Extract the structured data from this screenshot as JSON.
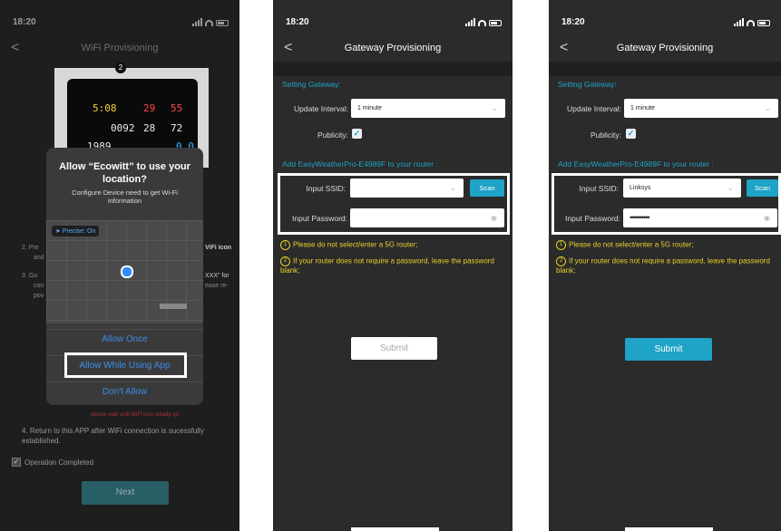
{
  "screen1": {
    "status_time": "18:20",
    "back_glyph": "<",
    "nav_title": "WiFi Provisioning",
    "device_marker": "2",
    "lcd_values": [
      "5:08",
      "29",
      "55",
      "0092",
      "28",
      "72",
      "1989",
      "0.0"
    ],
    "dialog": {
      "title": "Allow “Ecowitt” to use your location?",
      "subtitle": "Configure Device need to get Wi-Fi information",
      "precise_label": "Precise: On",
      "allow_once": "Allow Once",
      "allow_while_using": "Allow While Using App",
      "dont_allow": "Don't Allow"
    },
    "bg_step2_left": "2. Pre",
    "bg_step2_left_b": "and",
    "bg_step3_left": "3. Go",
    "bg_step3_left_b": "con",
    "bg_step3_left_c": "pov",
    "bg_step2_right": "ViFi icon",
    "bg_step3_right": "XXX\" for",
    "bg_step3_right_b": "ease re-",
    "red_note": "please wait until WiFi icon steady up",
    "step4": "4. Return to this APP after WiFi connection is sucessfully established.",
    "operation_completed": "Operation Completed",
    "next_label": "Next"
  },
  "screen2": {
    "status_time": "18:20",
    "back_glyph": "<",
    "nav_title": "Gateway Provisioning",
    "section_gateway": "Setting Gateway:",
    "update_interval_label": "Update Interval:",
    "update_interval_value": "1 minute",
    "publicity_label": "Publicity:",
    "add_router_label": "Add EasyWeatherPro-E4989F to your router :",
    "ssid_label": "Input SSID:",
    "ssid_value": "",
    "scan_label": "Scan",
    "password_label": "Input Password:",
    "password_value": "",
    "note1_num": "1",
    "note1": "Please do not select/enter a 5G router;",
    "note2_num": "2",
    "note2": "If your router does not require a password, leave the password blank;",
    "submit_label": "Submit"
  },
  "screen3": {
    "status_time": "18:20",
    "back_glyph": "<",
    "nav_title": "Gateway Provisioning",
    "section_gateway": "Setting Gateway:",
    "update_interval_label": "Update Interval:",
    "update_interval_value": "1 minute",
    "publicity_label": "Publicity:",
    "add_router_label": "Add EasyWeatherPro-E4989F to your router :",
    "ssid_label": "Input SSID:",
    "ssid_value": "Linksys",
    "scan_label": "Scan",
    "password_label": "Input Password:",
    "password_value": "••••••••••",
    "note1_num": "1",
    "note1": "Please do not select/enter a 5G router;",
    "note2_num": "2",
    "note2": "If your router does not require a password, leave the password blank;",
    "submit_label": "Submit"
  },
  "colors": {
    "accent": "#1fa3c7",
    "note_yellow": "#e7cf2a",
    "link_blue": "#3b8eea"
  }
}
